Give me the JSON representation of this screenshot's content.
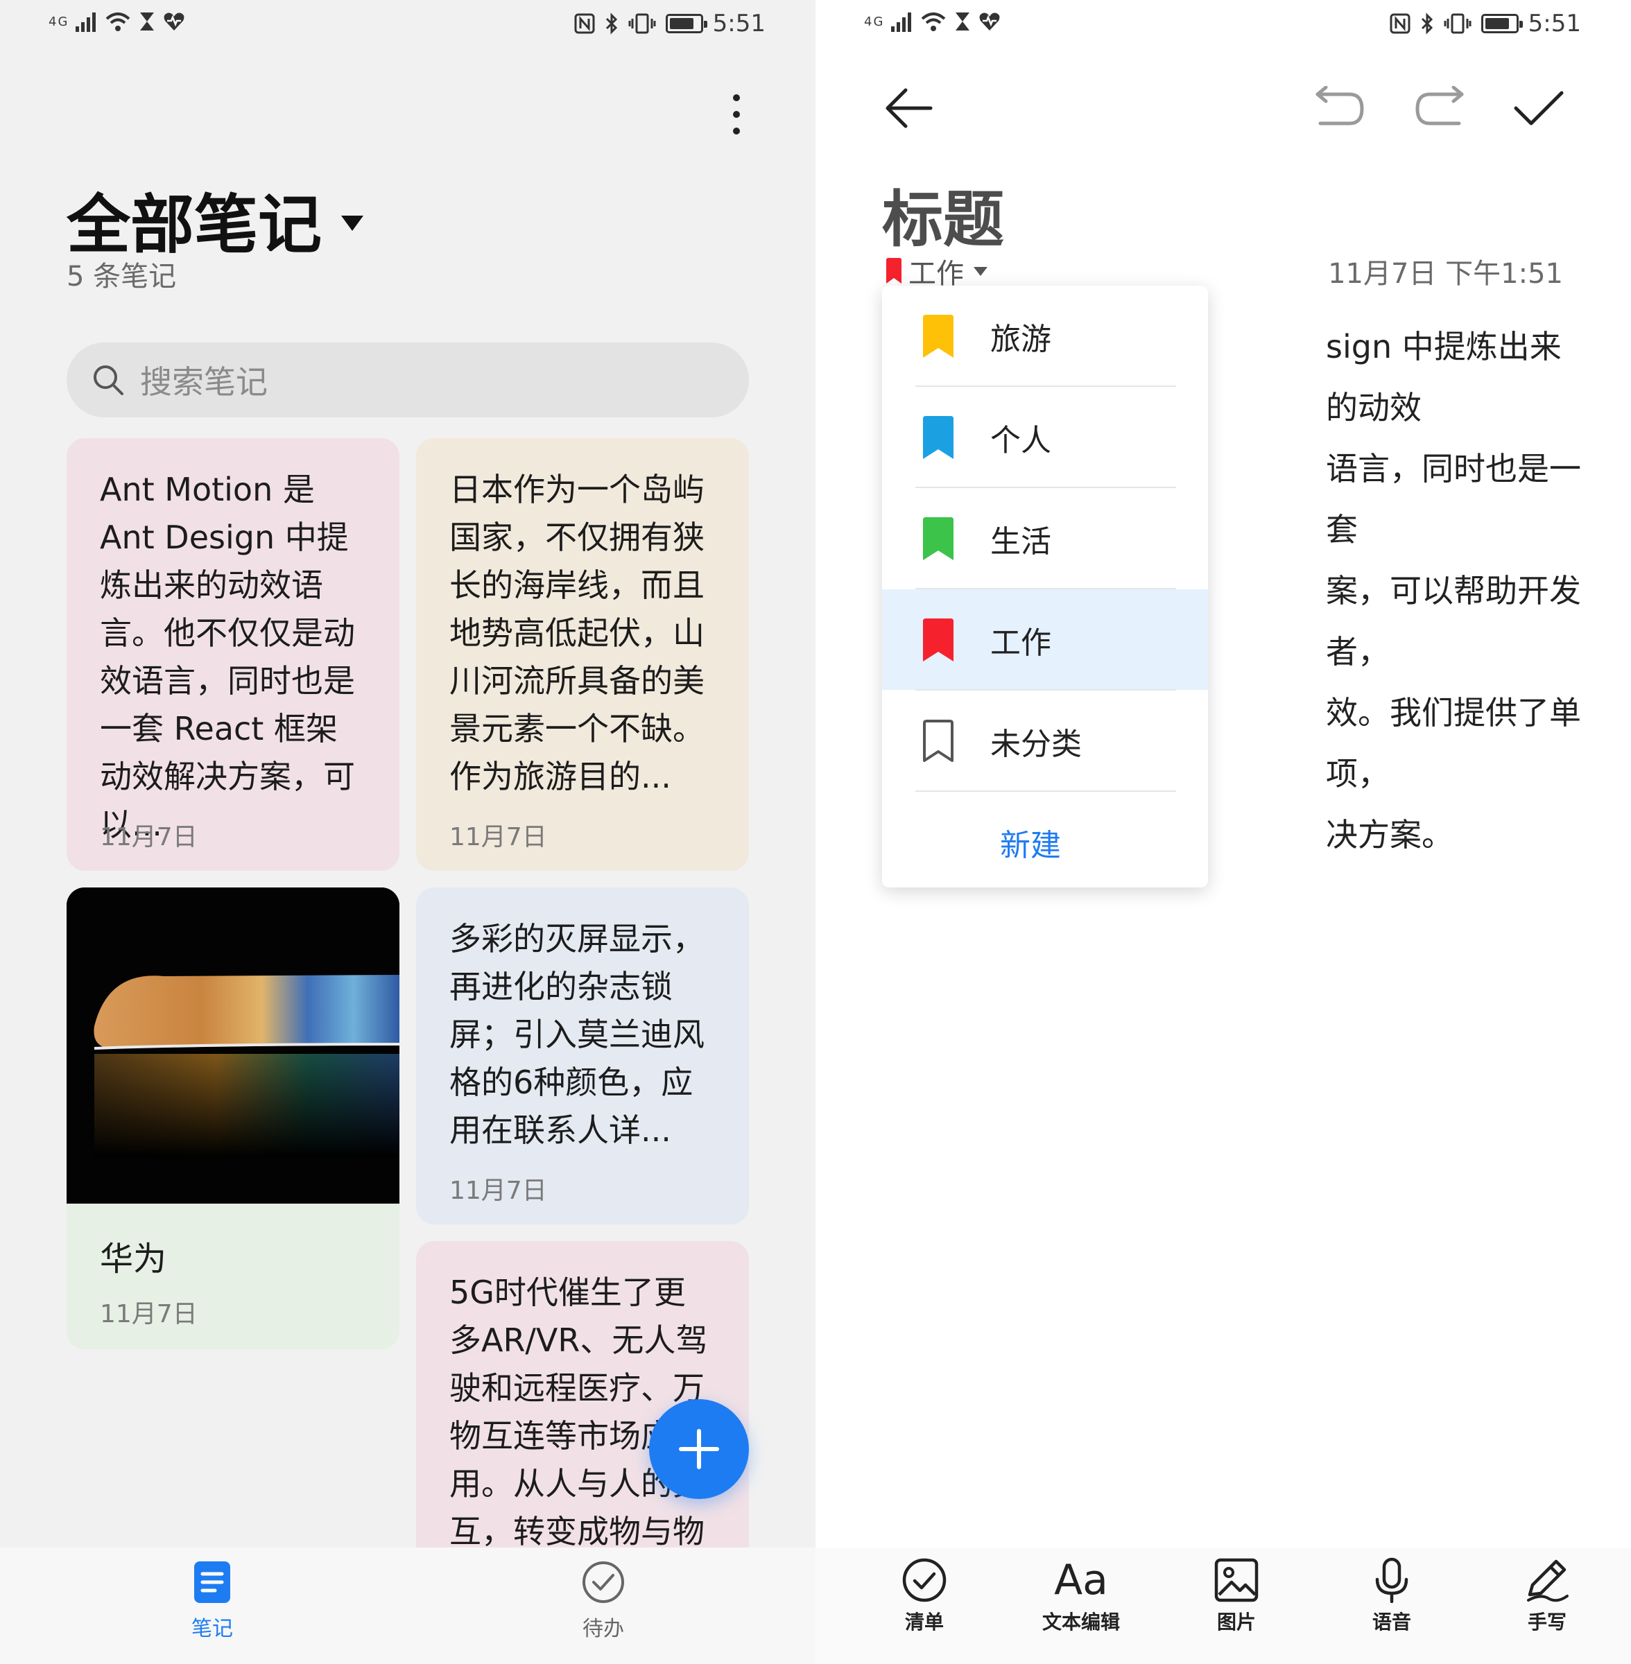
{
  "status": {
    "signal": "4G",
    "time": "5:51"
  },
  "notes_list": {
    "title": "全部笔记",
    "count": "5 条笔记",
    "search_placeholder": "搜索笔记",
    "cards": [
      {
        "text": "Ant Motion 是 Ant Design 中提炼出来的动效语言。他不仅仅是动效语言，同时也是一套 React 框架动效解决方案，可以...",
        "date": "11月7日"
      },
      {
        "text": "日本作为一个岛屿国家，不仅拥有狭长的海岸线，而且地势高低起伏，山川河流所具备的美景元素一个不缺。作为旅游目的...",
        "date": "11月7日"
      },
      {
        "title": "华为",
        "date": "11月7日"
      },
      {
        "text": "多彩的灭屏显示，再进化的杂志锁屏；引入莫兰迪风格的6种颜色，应用在联系人详...",
        "date": "11月7日"
      },
      {
        "text": "5G时代催生了更多AR/VR、无人驾驶和远程医疗、万物互连等市场应用。从人与人的交互，转变成物与物"
      }
    ],
    "nav": {
      "notes": "笔记",
      "todo": "待办"
    }
  },
  "editor": {
    "title": "标题",
    "category": "工作",
    "date": "11月7日 下午1:51",
    "body_lines": [
      "sign 中提炼出来的动效",
      "语言，同时也是一套",
      "案，可以帮助开发者，",
      "效。我们提供了单项，",
      "决方案。"
    ],
    "dropdown": {
      "items": [
        {
          "label": "旅游",
          "color": "#FFC107"
        },
        {
          "label": "个人",
          "color": "#1BA1E2"
        },
        {
          "label": "生活",
          "color": "#3BC34A"
        },
        {
          "label": "工作",
          "color": "#F5222D"
        },
        {
          "label": "未分类",
          "color": "#555555"
        }
      ],
      "new_label": "新建"
    },
    "toolbar": {
      "checklist": "清单",
      "text_edit": "文本编辑",
      "image": "图片",
      "voice": "语音",
      "handwrite": "手写"
    }
  },
  "colors": {
    "accent": "#1E7CF2",
    "red": "#F5222D"
  }
}
